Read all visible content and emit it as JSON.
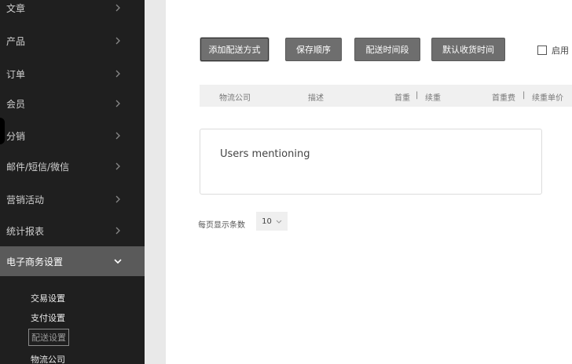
{
  "sidebar": {
    "items": [
      {
        "label": "文章"
      },
      {
        "label": "产品"
      },
      {
        "label": "订单"
      },
      {
        "label": "会员"
      },
      {
        "label": "分销"
      },
      {
        "label": "邮件/短信/微信"
      },
      {
        "label": "营销活动"
      },
      {
        "label": "统计报表"
      },
      {
        "label": "电子商务设置"
      }
    ],
    "sub_items": [
      {
        "label": "交易设置"
      },
      {
        "label": "支付设置"
      },
      {
        "label": "配送设置"
      },
      {
        "label": "物流公司"
      }
    ]
  },
  "toolbar": {
    "add_delivery_label": "添加配送方式",
    "save_order_label": "保存顺序",
    "delivery_time_label": "配送时间段",
    "default_receive_time_label": "默认收货时间",
    "enable_label": "启用"
  },
  "table": {
    "headers": {
      "company": "物流公司",
      "description": "描述",
      "first_weight": "首重",
      "sep1": "|",
      "continued_weight": "续重",
      "first_weight_fee": "首重费",
      "sep2": "|",
      "continued_unit_price": "续重单价"
    },
    "empty_text": "Users mentioning"
  },
  "pager": {
    "label": "每页显示条数",
    "page_size": "10"
  },
  "colors": {
    "sidebar_bg": "#1f1f1f",
    "active_item_bg": "#5a5a5a",
    "button_bg": "#6e6e6e"
  }
}
